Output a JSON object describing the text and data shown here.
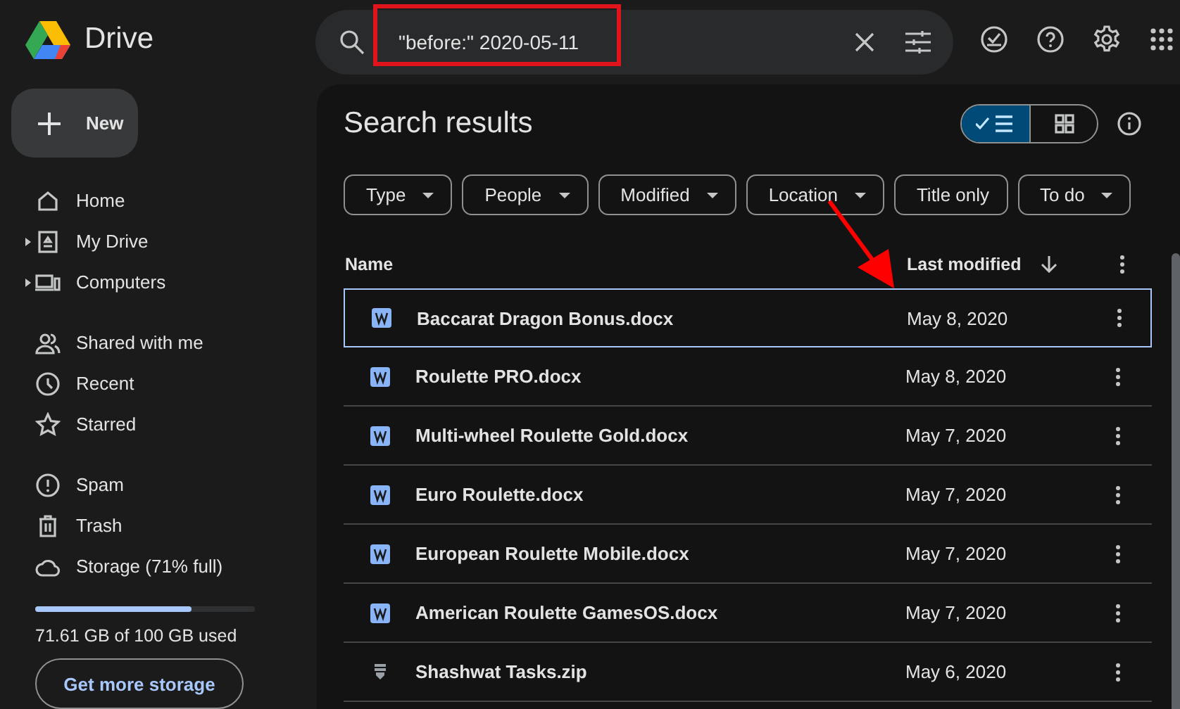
{
  "app": {
    "name": "Drive"
  },
  "search": {
    "value": "\"before:\" 2020-05-11"
  },
  "new_button": {
    "label": "New"
  },
  "sidebar": {
    "groups": [
      {
        "items": [
          {
            "label": "Home",
            "expander": false
          },
          {
            "label": "My Drive",
            "expander": true
          },
          {
            "label": "Computers",
            "expander": true
          }
        ]
      },
      {
        "items": [
          {
            "label": "Shared with me",
            "expander": false
          },
          {
            "label": "Recent",
            "expander": false
          },
          {
            "label": "Starred",
            "expander": false
          }
        ]
      },
      {
        "items": [
          {
            "label": "Spam",
            "expander": false
          },
          {
            "label": "Trash",
            "expander": false
          },
          {
            "label": "Storage (71% full)",
            "expander": false
          }
        ]
      }
    ]
  },
  "storage": {
    "level": 0.71,
    "usage": "71.61 GB of 100 GB used",
    "button": "Get more storage"
  },
  "title": "Search results",
  "view_toggle": [
    {
      "selected": true
    },
    {
      "selected": false
    }
  ],
  "filters": [
    {
      "label": "Type",
      "dropdown": true
    },
    {
      "label": "People",
      "dropdown": true
    },
    {
      "label": "Modified",
      "dropdown": true
    },
    {
      "label": "Location",
      "dropdown": true
    },
    {
      "label": "Title only",
      "dropdown": false
    },
    {
      "label": "To do",
      "dropdown": true
    }
  ],
  "table": {
    "columns": [
      "Name",
      "Last modified"
    ],
    "rows": [
      {
        "kind": "docx",
        "name": "Baccarat Dragon Bonus.docx",
        "modified": "May 8, 2020",
        "selected": true
      },
      {
        "kind": "docx",
        "name": "Roulette PRO.docx",
        "modified": "May 8, 2020",
        "selected": false
      },
      {
        "kind": "docx",
        "name": "Multi-wheel Roulette Gold.docx",
        "modified": "May 7, 2020",
        "selected": false
      },
      {
        "kind": "docx",
        "name": "Euro Roulette.docx",
        "modified": "May 7, 2020",
        "selected": false
      },
      {
        "kind": "docx",
        "name": "European Roulette Mobile.docx",
        "modified": "May 7, 2020",
        "selected": false
      },
      {
        "kind": "docx",
        "name": "American Roulette GamesOS.docx",
        "modified": "May 7, 2020",
        "selected": false
      },
      {
        "kind": "zip",
        "name": "Shashwat Tasks.zip",
        "modified": "May 6, 2020",
        "selected": false
      }
    ]
  },
  "annotations": {
    "highlight_box": true,
    "arrow": true
  }
}
